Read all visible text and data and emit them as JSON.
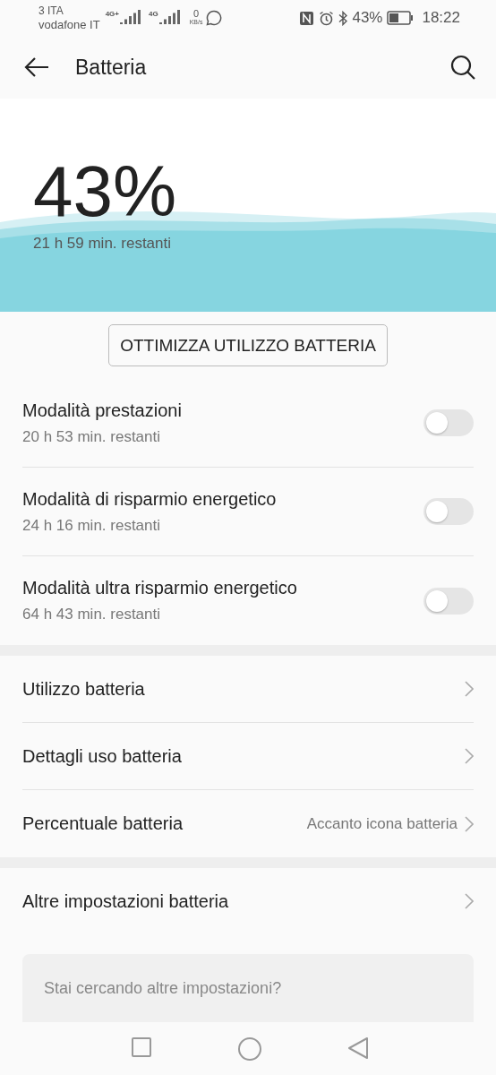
{
  "status_bar": {
    "carrier_1": "3 ITA",
    "carrier_2": "vodafone IT",
    "network_1": "4G+",
    "network_2": "4G",
    "speed_value": "0",
    "speed_unit": "KB/s",
    "battery": "43%",
    "time": "18:22"
  },
  "header": {
    "title": "Batteria"
  },
  "battery": {
    "percent": "43%",
    "remaining": "21 h 59 min. restanti"
  },
  "optimize_button": "OTTIMIZZA UTILIZZO BATTERIA",
  "modes": [
    {
      "title": "Modalità prestazioni",
      "subtitle": "20 h 53 min. restanti",
      "on": false
    },
    {
      "title": "Modalità di risparmio energetico",
      "subtitle": "24 h 16 min. restanti",
      "on": false
    },
    {
      "title": "Modalità ultra risparmio energetico",
      "subtitle": "64 h 43 min. restanti",
      "on": false
    }
  ],
  "settings": [
    {
      "label": "Utilizzo batteria"
    },
    {
      "label": "Dettagli uso batteria"
    },
    {
      "label": "Percentuale batteria",
      "value": "Accanto icona batteria"
    }
  ],
  "more_settings": {
    "label": "Altre impostazioni batteria"
  },
  "search": {
    "placeholder": "Stai cercando altre impostazioni?"
  }
}
